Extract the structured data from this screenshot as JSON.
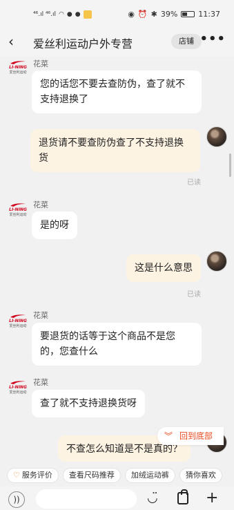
{
  "status_bar": {
    "signal_left": "⁴⁶.ıl ⁴⁶.ıl",
    "battery": "39%",
    "time": "11:37"
  },
  "header": {
    "title": "爱丝利运动户外专营",
    "store_label": "店铺",
    "back_icon": "‹",
    "more_icon": "•••"
  },
  "shop_avatar": {
    "brand": "LI-NING",
    "sub": "爱丝利运动"
  },
  "messages": [
    {
      "from": "shop",
      "sender": "花菜",
      "text": "您的话您不要去查防伪，查了就不支持退换了"
    },
    {
      "from": "user",
      "text": "退货请不要查防伪查了不支持退换货",
      "status": "已读"
    },
    {
      "from": "shop",
      "sender": "花菜",
      "text": "是的呀"
    },
    {
      "from": "user",
      "text": "这是什么意思",
      "status": "已读"
    },
    {
      "from": "shop",
      "sender": "花菜",
      "text": "要退货的话等于这个商品不是您的，您查什么"
    },
    {
      "from": "shop",
      "sender": "花菜",
      "text": "查了就不支持退换货呀"
    },
    {
      "from": "user",
      "text": "不查怎么知道是不是真的？"
    }
  ],
  "back_to_bottom": {
    "icon": "chevron-double-down-icon",
    "label": "回到底部"
  },
  "quick_replies": [
    "服务评价",
    "查看尺码推荐",
    "加绒运动裤",
    "猜你喜欢"
  ],
  "input": {
    "placeholder": ""
  },
  "colors": {
    "accent": "#e84a1d",
    "out_bubble": "#fdf3e3",
    "brand_red": "#d0021b"
  }
}
